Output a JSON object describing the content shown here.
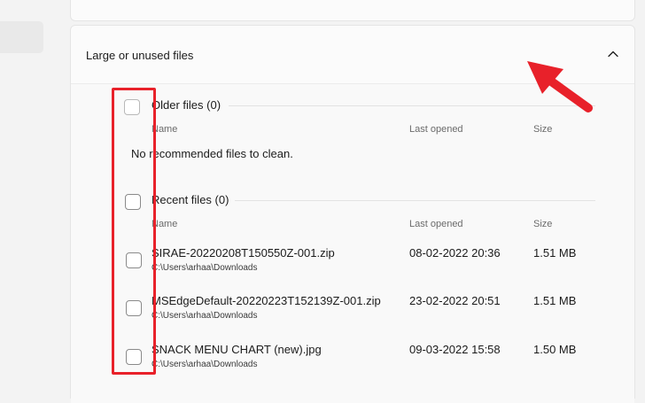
{
  "section": {
    "title": "Large or unused files"
  },
  "columns": {
    "name": "Name",
    "last_opened": "Last opened",
    "size": "Size"
  },
  "older": {
    "title": "Older files (0)",
    "empty_message": "No recommended files to clean."
  },
  "recent": {
    "title": "Recent files (0)",
    "files": [
      {
        "name": "SIRAE-20220208T150550Z-001.zip",
        "path": "C:\\Users\\arhaa\\Downloads",
        "last_opened": "08-02-2022 20:36",
        "size": "1.51 MB"
      },
      {
        "name": "MSEdgeDefault-20220223T152139Z-001.zip",
        "path": "C:\\Users\\arhaa\\Downloads",
        "last_opened": "23-02-2022 20:51",
        "size": "1.51 MB"
      },
      {
        "name": "SNACK MENU CHART (new).jpg",
        "path": "C:\\Users\\arhaa\\Downloads",
        "last_opened": "09-03-2022 15:58",
        "size": "1.50 MB"
      }
    ]
  },
  "colors": {
    "highlight": "#e8212a",
    "accent_arrow": "#e8212a"
  },
  "icons": {
    "collapse": "chevron-up-icon",
    "pointer": "arrow-annotation-icon"
  }
}
